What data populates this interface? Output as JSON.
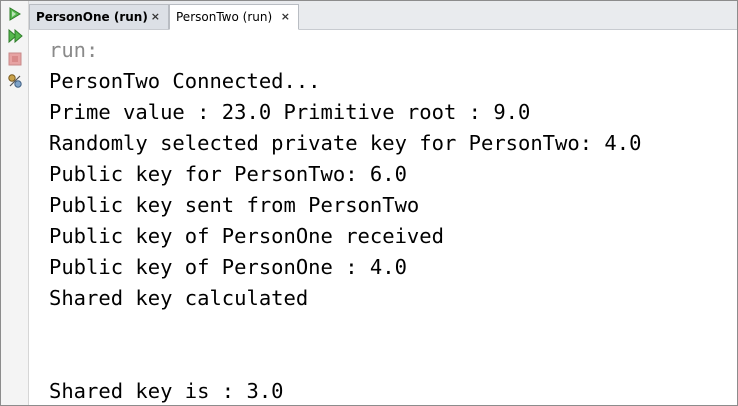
{
  "tabs": [
    {
      "label": "PersonOne (run)",
      "close": "×"
    },
    {
      "label": "PersonTwo (run)",
      "close": "×"
    }
  ],
  "toolbar": {
    "buttons": [
      "run-icon",
      "rerun-icon",
      "stop-icon",
      "settings-icon"
    ],
    "colors": {
      "run": "#3aa33a",
      "stop": "#d46a6a"
    }
  },
  "console": {
    "lines": [
      "run:",
      "PersonTwo Connected...",
      "Prime value : 23.0 Primitive root : 9.0",
      "Randomly selected private key for PersonTwo: 4.0",
      "Public key for PersonTwo: 6.0",
      "Public key sent from PersonTwo",
      "Public key of PersonOne received",
      "Public key of PersonOne : 4.0",
      "Shared key calculated",
      "",
      "",
      "Shared key is : 3.0"
    ]
  }
}
